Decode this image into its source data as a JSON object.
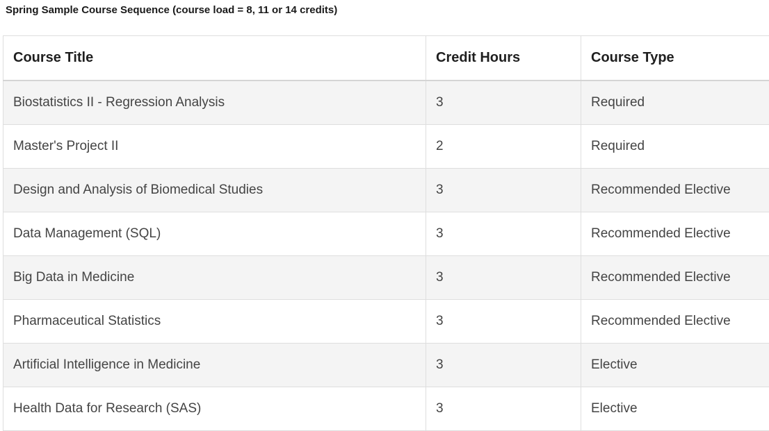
{
  "caption": "Spring Sample Course Sequence (course load = 8, 11 or 14 credits)",
  "table": {
    "headers": [
      "Course Title",
      "Credit Hours",
      "Course Type"
    ],
    "rows": [
      [
        "Biostatistics II - Regression Analysis",
        "3",
        "Required"
      ],
      [
        "Master's Project II",
        "2",
        "Required"
      ],
      [
        "Design and Analysis of Biomedical Studies",
        "3",
        "Recommended Elective"
      ],
      [
        "Data Management (SQL)",
        "3",
        "Recommended Elective"
      ],
      [
        "Big Data in Medicine",
        "3",
        "Recommended Elective"
      ],
      [
        "Pharmaceutical Statistics",
        "3",
        "Recommended Elective"
      ],
      [
        "Artificial Intelligence in Medicine",
        "3",
        "Elective"
      ],
      [
        "Health Data for Research (SAS)",
        "3",
        "Elective"
      ]
    ]
  },
  "colors": {
    "striped_row": "#f4f4f4",
    "border": "#dedede",
    "text": "#444444"
  }
}
